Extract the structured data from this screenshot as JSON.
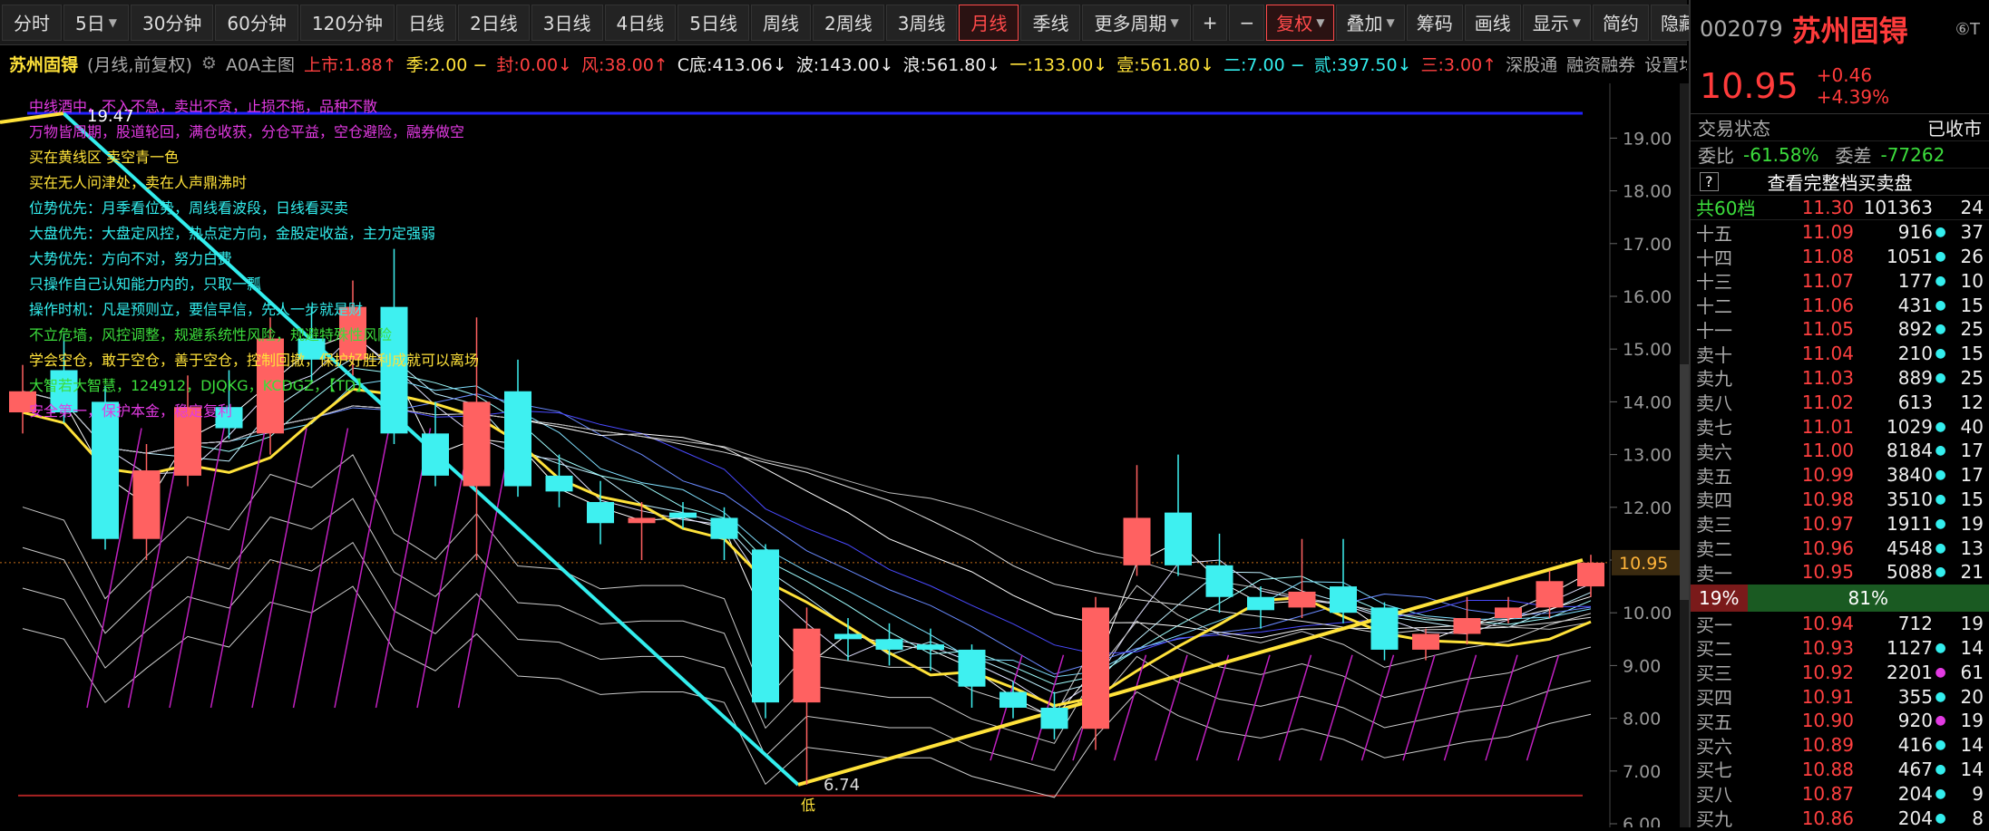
{
  "toolbar": {
    "items": [
      {
        "label": "分时"
      },
      {
        "label": "5日",
        "dd": true
      },
      {
        "label": "30分钟"
      },
      {
        "label": "60分钟"
      },
      {
        "label": "120分钟"
      },
      {
        "label": "日线"
      },
      {
        "label": "2日线"
      },
      {
        "label": "3日线"
      },
      {
        "label": "4日线"
      },
      {
        "label": "5日线"
      },
      {
        "label": "周线"
      },
      {
        "label": "2周线"
      },
      {
        "label": "3周线"
      },
      {
        "label": "月线",
        "active": true
      },
      {
        "label": "季线"
      },
      {
        "label": "更多周期",
        "dd": true
      }
    ],
    "right_items": [
      {
        "label": "+"
      },
      {
        "label": "−"
      },
      {
        "label": "复权",
        "active": true,
        "dd": true
      },
      {
        "label": "叠加",
        "dd": true
      },
      {
        "label": "筹码"
      },
      {
        "label": "画线"
      },
      {
        "label": "显示",
        "dd": true
      },
      {
        "label": "简约"
      },
      {
        "label": "隐藏 ▸▸"
      },
      {
        "label": "⛶"
      }
    ]
  },
  "info": {
    "stock": "苏州固锝",
    "mode": "(月线,前复权)",
    "indicator": "A0A主图",
    "vals": [
      {
        "t": "上市:1.88↑",
        "c": "up"
      },
      {
        "t": "季:2.00 −",
        "c": "ye"
      },
      {
        "t": "封:0.00↓",
        "c": "up"
      },
      {
        "t": "风:38.00↑",
        "c": "up"
      },
      {
        "t": "C底:413.06↓",
        "c": "wh"
      },
      {
        "t": "波:143.00↓",
        "c": "wh"
      },
      {
        "t": "浪:561.80↓",
        "c": "wh"
      },
      {
        "t": "一:133.00↓",
        "c": "ye"
      },
      {
        "t": "壹:561.80↓",
        "c": "ye"
      },
      {
        "t": "二:7.00 −",
        "c": "cy"
      },
      {
        "t": "贰:397.50↓",
        "c": "cy"
      },
      {
        "t": "三:3.00↑",
        "c": "up"
      },
      {
        "t": "深股通",
        "c": "gr"
      },
      {
        "t": "融资融券",
        "c": "gr"
      },
      {
        "t": "设置均线 ▾",
        "c": "gr"
      }
    ]
  },
  "chart_notes": [
    {
      "t": "中线酒中，不入不急，卖出不贪，止损不拖，品种不散",
      "c": "mg"
    },
    {
      "t": "万物皆周期，股道轮回，满仓收获，分仓平益，空仓避险，融券做空",
      "c": "mg"
    },
    {
      "t": "买在黄线区    卖空青一色",
      "c": "ye"
    },
    {
      "t": "买在无人问津处，卖在人声鼎沸时",
      "c": "ye"
    },
    {
      "t": "位势优先：月季看位势，周线看波段，日线看买卖",
      "c": "cy"
    },
    {
      "t": "大盘优先：大盘定风控，热点定方向，金股定收益，主力定强弱",
      "c": "cy"
    },
    {
      "t": "大势优先：方向不对，努力白费",
      "c": "cy"
    },
    {
      "t": "只操作自己认知能力内的，只取一瓢",
      "c": "cy"
    },
    {
      "t": "操作时机：凡是预则立，要信早信，先人一步就是财",
      "c": "cy"
    },
    {
      "t": "不立危墙，风控调整，规避系统性风险，规避特殊性风险",
      "c": "dn"
    },
    {
      "t": "学会空仓，敢于空仓，善于空仓，控制回撤，保护好胜利成就可以离场",
      "c": "ye"
    },
    {
      "t": "大智若大智慧，124912，DJQKG，KCDGZ，【TD】",
      "c": "dn"
    },
    {
      "t": "安全第一，保护本金，稳定复利",
      "c": "mg"
    }
  ],
  "chart_data": {
    "type": "candlestick",
    "ylim": [
      6.0,
      20.0
    ],
    "yticks": [
      "19.00",
      "18.00",
      "17.00",
      "16.00",
      "15.00",
      "14.00",
      "13.00",
      "12.00",
      "11.00",
      "10.00",
      "9.00",
      "8.00",
      "7.00",
      "6.00"
    ],
    "current_price_label": "10.95",
    "high_label": "19.47",
    "low_label": "6.74",
    "low_marker": "低",
    "candles": [
      [
        13.8,
        14.2,
        13.4,
        14.7
      ],
      [
        14.6,
        13.8,
        13.6,
        15.3
      ],
      [
        14.0,
        11.4,
        11.2,
        14.3
      ],
      [
        11.4,
        12.7,
        11.0,
        13.2
      ],
      [
        12.6,
        13.9,
        12.4,
        14.5
      ],
      [
        13.9,
        13.5,
        13.3,
        14.6
      ],
      [
        13.4,
        15.2,
        13.0,
        15.6
      ],
      [
        15.2,
        14.8,
        14.4,
        15.8
      ],
      [
        14.8,
        15.8,
        14.5,
        16.3
      ],
      [
        15.8,
        13.4,
        13.2,
        16.9
      ],
      [
        13.4,
        12.6,
        12.4,
        14.0
      ],
      [
        12.4,
        14.0,
        11.0,
        15.6
      ],
      [
        14.2,
        12.4,
        12.2,
        14.8
      ],
      [
        12.6,
        12.3,
        12.0,
        13.0
      ],
      [
        12.1,
        11.7,
        11.3,
        12.5
      ],
      [
        11.7,
        11.8,
        11.0,
        12.1
      ],
      [
        11.9,
        11.8,
        11.6,
        12.1
      ],
      [
        11.8,
        11.4,
        11.0,
        12.0
      ],
      [
        11.2,
        8.3,
        8.0,
        11.3
      ],
      [
        8.3,
        9.7,
        6.74,
        10.1
      ],
      [
        9.6,
        9.5,
        9.1,
        9.9
      ],
      [
        9.5,
        9.3,
        9.0,
        9.8
      ],
      [
        9.4,
        9.3,
        8.9,
        9.7
      ],
      [
        9.3,
        8.6,
        8.2,
        9.4
      ],
      [
        8.5,
        8.2,
        8.0,
        8.7
      ],
      [
        8.2,
        7.8,
        7.6,
        8.5
      ],
      [
        7.8,
        10.1,
        7.4,
        10.3
      ],
      [
        10.9,
        11.8,
        10.7,
        12.8
      ],
      [
        11.9,
        10.9,
        10.7,
        13.0
      ],
      [
        10.9,
        10.3,
        10.0,
        11.5
      ],
      [
        10.3,
        10.05,
        9.7,
        10.5
      ],
      [
        10.1,
        10.4,
        9.9,
        11.4
      ],
      [
        10.5,
        10.0,
        9.8,
        11.4
      ],
      [
        10.1,
        9.3,
        9.1,
        10.2
      ],
      [
        9.3,
        9.6,
        9.1,
        9.7
      ],
      [
        9.6,
        9.9,
        9.4,
        10.3
      ],
      [
        9.9,
        10.1,
        9.8,
        10.3
      ],
      [
        10.1,
        10.6,
        9.9,
        10.8
      ],
      [
        10.5,
        10.95,
        10.3,
        11.1
      ]
    ]
  },
  "right": {
    "code": "002079",
    "name": "苏州固锝",
    "badge": "⑥T",
    "price": "10.95",
    "chg": "+0.46",
    "pct": "+4.39%",
    "status_label": "交易状态",
    "status": "已收市",
    "wb_label": "委比",
    "wb": "-61.58%",
    "wc_label": "委差",
    "wc": "-77262",
    "help": "?",
    "full_book": "查看完整档买卖盘",
    "total_label": "共60档",
    "total_price": "11.30",
    "total_vol": "101363",
    "total_n": "24",
    "asks": [
      {
        "l": "十五",
        "p": "11.09",
        "v": "916",
        "d": "cy",
        "n": "37"
      },
      {
        "l": "十四",
        "p": "11.08",
        "v": "1051",
        "d": "cy",
        "n": "26"
      },
      {
        "l": "十三",
        "p": "11.07",
        "v": "177",
        "d": "cy",
        "n": "10"
      },
      {
        "l": "十二",
        "p": "11.06",
        "v": "431",
        "d": "cy",
        "n": "15"
      },
      {
        "l": "十一",
        "p": "11.05",
        "v": "892",
        "d": "cy",
        "n": "25"
      },
      {
        "l": "卖十",
        "p": "11.04",
        "v": "210",
        "d": "cy",
        "n": "15"
      },
      {
        "l": "卖九",
        "p": "11.03",
        "v": "889",
        "d": "cy",
        "n": "25"
      },
      {
        "l": "卖八",
        "p": "11.02",
        "v": "613",
        "d": "",
        "n": "12"
      },
      {
        "l": "卖七",
        "p": "11.01",
        "v": "1029",
        "d": "cy",
        "n": "40"
      },
      {
        "l": "卖六",
        "p": "11.00",
        "v": "8184",
        "d": "cy",
        "n": "17"
      },
      {
        "l": "卖五",
        "p": "10.99",
        "v": "3840",
        "d": "cy",
        "n": "17"
      },
      {
        "l": "卖四",
        "p": "10.98",
        "v": "3510",
        "d": "cy",
        "n": "15"
      },
      {
        "l": "卖三",
        "p": "10.97",
        "v": "1911",
        "d": "cy",
        "n": "19"
      },
      {
        "l": "卖二",
        "p": "10.96",
        "v": "4548",
        "d": "cy",
        "n": "13"
      },
      {
        "l": "卖一",
        "p": "10.95",
        "v": "5088",
        "d": "cy",
        "n": "21"
      }
    ],
    "split_a": "19%",
    "split_b": "81%",
    "bids": [
      {
        "l": "买一",
        "p": "10.94",
        "v": "712",
        "d": "",
        "n": "19"
      },
      {
        "l": "买二",
        "p": "10.93",
        "v": "1127",
        "d": "cy",
        "n": "14"
      },
      {
        "l": "买三",
        "p": "10.92",
        "v": "2201",
        "d": "mg",
        "n": "61"
      },
      {
        "l": "买四",
        "p": "10.91",
        "v": "355",
        "d": "cy",
        "n": "20"
      },
      {
        "l": "买五",
        "p": "10.90",
        "v": "920",
        "d": "mg",
        "n": "19"
      },
      {
        "l": "买六",
        "p": "10.89",
        "v": "416",
        "d": "cy",
        "n": "14"
      },
      {
        "l": "买七",
        "p": "10.88",
        "v": "467",
        "d": "cy",
        "n": "14"
      },
      {
        "l": "买八",
        "p": "10.87",
        "v": "204",
        "d": "cy",
        "n": "9"
      },
      {
        "l": "买九",
        "p": "10.86",
        "v": "204",
        "d": "cy",
        "n": "8"
      }
    ]
  }
}
